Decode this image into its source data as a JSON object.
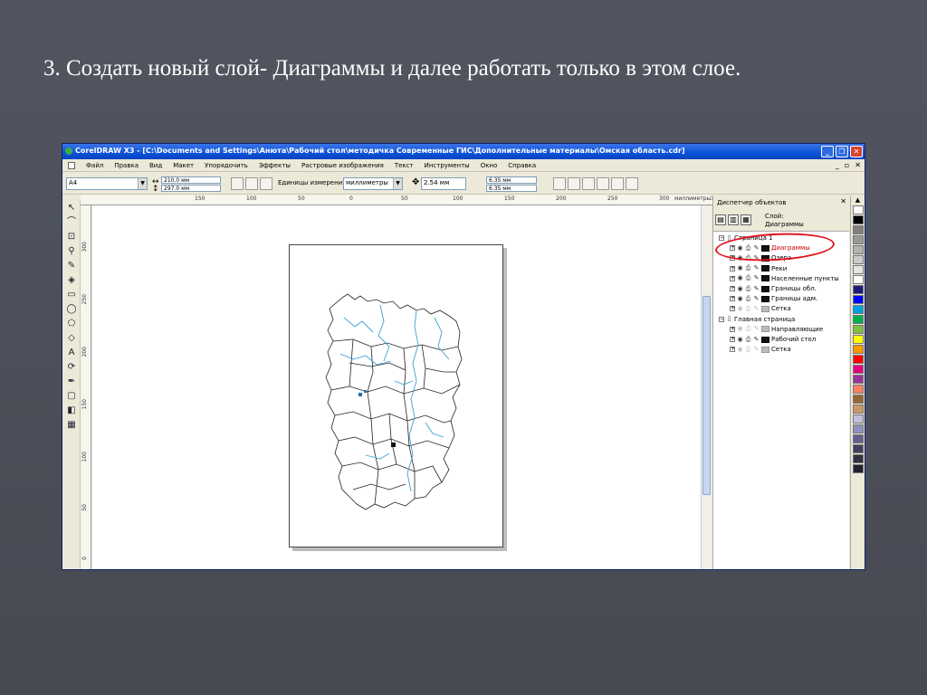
{
  "slide": {
    "title": "3. Создать новый слой- Диаграммы и далее работать только в этом слое."
  },
  "app": {
    "title": "CorelDRAW X3 - [C:\\Documents and Settings\\Анюта\\Рабочий стол\\методичка Современные ГИС\\Дополнительные материалы\\Омская область.cdr]",
    "window_buttons": {
      "minimize": "_",
      "maximize": "❐",
      "close": "✕"
    },
    "menu": [
      "Файл",
      "Правка",
      "Вид",
      "Макет",
      "Упорядочить",
      "Эффекты",
      "Растровые изображения",
      "Текст",
      "Инструменты",
      "Окно",
      "Справка"
    ],
    "mdi_buttons": [
      "_",
      "▫",
      "✕"
    ]
  },
  "propbar": {
    "paper_size": "A4",
    "width": "210.0 мм",
    "height": "297.0 мм",
    "units_label": "Единицы измерения:",
    "units_value": "миллиметры",
    "nudge": "2.54 мм",
    "dup_x": "6.35 мм",
    "dup_y": "6.35 мм"
  },
  "rulers": {
    "horizontal": [
      "150",
      "100",
      "50",
      "0",
      "50",
      "100",
      "150",
      "200",
      "250",
      "300",
      "350"
    ],
    "vertical": [
      "300",
      "250",
      "200",
      "150",
      "100",
      "50",
      "0"
    ],
    "units": "миллиметры"
  },
  "docker": {
    "title": "Диспетчер объектов",
    "close": "✕",
    "layer_label": "Слой:",
    "current_layer": "Диаграммы",
    "tree": [
      {
        "label": "Страница 1",
        "level": 0,
        "expander": "−"
      },
      {
        "label": "Диаграммы",
        "level": 1,
        "color": "#cc0000",
        "greyed": false
      },
      {
        "label": "Озера",
        "level": 1,
        "greyed": false
      },
      {
        "label": "Реки",
        "level": 1,
        "greyed": false
      },
      {
        "label": "Населенные пункты",
        "level": 1,
        "greyed": false
      },
      {
        "label": "Границы обл.",
        "level": 1,
        "greyed": false
      },
      {
        "label": "Границы адм.",
        "level": 1,
        "greyed": false
      },
      {
        "label": "Сетка",
        "level": 1,
        "greyed": true
      },
      {
        "label": "Главная страница",
        "level": 0,
        "expander": "−"
      },
      {
        "label": "Направляющие",
        "level": 1,
        "greyed": true
      },
      {
        "label": "Рабочий стол",
        "level": 1,
        "greyed": false
      },
      {
        "label": "Сетка",
        "level": 1,
        "greyed": true
      }
    ]
  },
  "palette": [
    "#ffffff",
    "#000000",
    "#7f7f7f",
    "#999999",
    "#b2b2b2",
    "#cccccc",
    "#e5e5e5",
    "#ffffff",
    "#1f1a7a",
    "#0000ff",
    "#00a0e0",
    "#00b050",
    "#7fc040",
    "#ffff00",
    "#ff9900",
    "#ff0000",
    "#e4007f",
    "#993399",
    "#ff8060",
    "#996633",
    "#cc9966",
    "#c0c0e0",
    "#9090c0",
    "#606090",
    "#404060",
    "#303040",
    "#202030"
  ],
  "icons": {
    "tools": [
      "pick-icon",
      "shape-icon",
      "crop-icon",
      "zoom-icon",
      "freehand-icon",
      "smart-fill-icon",
      "rectangle-icon",
      "ellipse-icon",
      "polygon-icon",
      "basic-shapes-icon",
      "text-icon",
      "interactive-blend-icon",
      "eyedropper-icon",
      "outline-icon",
      "fill-icon",
      "interactive-fill-icon"
    ]
  }
}
